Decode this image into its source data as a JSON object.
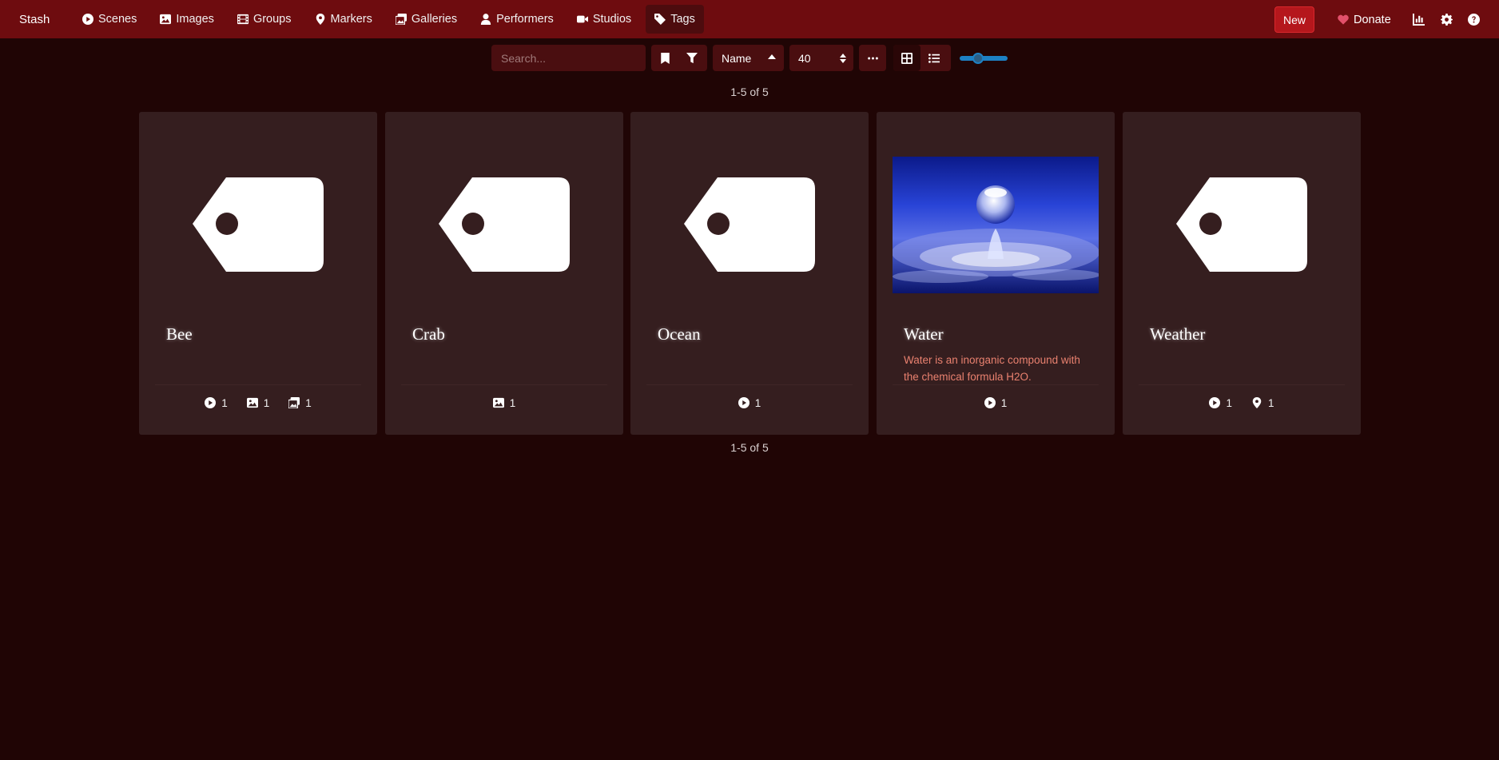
{
  "app": {
    "brand": "Stash"
  },
  "nav": {
    "items": [
      {
        "label": "Scenes",
        "icon": "play-circle-icon"
      },
      {
        "label": "Images",
        "icon": "image-icon"
      },
      {
        "label": "Groups",
        "icon": "film-icon"
      },
      {
        "label": "Markers",
        "icon": "map-marker-icon"
      },
      {
        "label": "Galleries",
        "icon": "images-icon"
      },
      {
        "label": "Performers",
        "icon": "user-icon"
      },
      {
        "label": "Studios",
        "icon": "video-icon"
      },
      {
        "label": "Tags",
        "icon": "tag-icon",
        "active": true
      }
    ],
    "new_label": "New",
    "donate_label": "Donate",
    "icons": [
      "chart-icon",
      "gear-icon",
      "help-icon"
    ]
  },
  "toolbar": {
    "search_placeholder": "Search...",
    "sort_by": "Name",
    "per_page": "40",
    "zoom_level_fraction": 0.35,
    "display_mode": "grid"
  },
  "pagination": {
    "top": "1-5 of 5",
    "bottom": "1-5 of 5"
  },
  "tags": [
    {
      "name": "Bee",
      "description": "",
      "image": "tag-placeholder",
      "stats": [
        {
          "icon": "play-circle-icon",
          "count": "1"
        },
        {
          "icon": "image-icon",
          "count": "1"
        },
        {
          "icon": "images-icon",
          "count": "1"
        }
      ]
    },
    {
      "name": "Crab",
      "description": "",
      "image": "tag-placeholder",
      "stats": [
        {
          "icon": "image-icon",
          "count": "1"
        }
      ]
    },
    {
      "name": "Ocean",
      "description": "",
      "image": "tag-placeholder",
      "stats": [
        {
          "icon": "play-circle-icon",
          "count": "1"
        }
      ]
    },
    {
      "name": "Water",
      "description": "Water is an inorganic compound with the chemical formula H2O.",
      "image": "water-drop-photo",
      "stats": [
        {
          "icon": "play-circle-icon",
          "count": "1"
        }
      ]
    },
    {
      "name": "Weather",
      "description": "",
      "image": "tag-placeholder",
      "stats": [
        {
          "icon": "play-circle-icon",
          "count": "1"
        },
        {
          "icon": "map-marker-icon",
          "count": "1"
        }
      ]
    }
  ],
  "colors": {
    "navbar": "#6e0c0f",
    "background": "#200505",
    "card": "#351e1f",
    "accent_button": "#b5171c",
    "description_text": "#e9816f",
    "slider": "#1d81c4"
  }
}
